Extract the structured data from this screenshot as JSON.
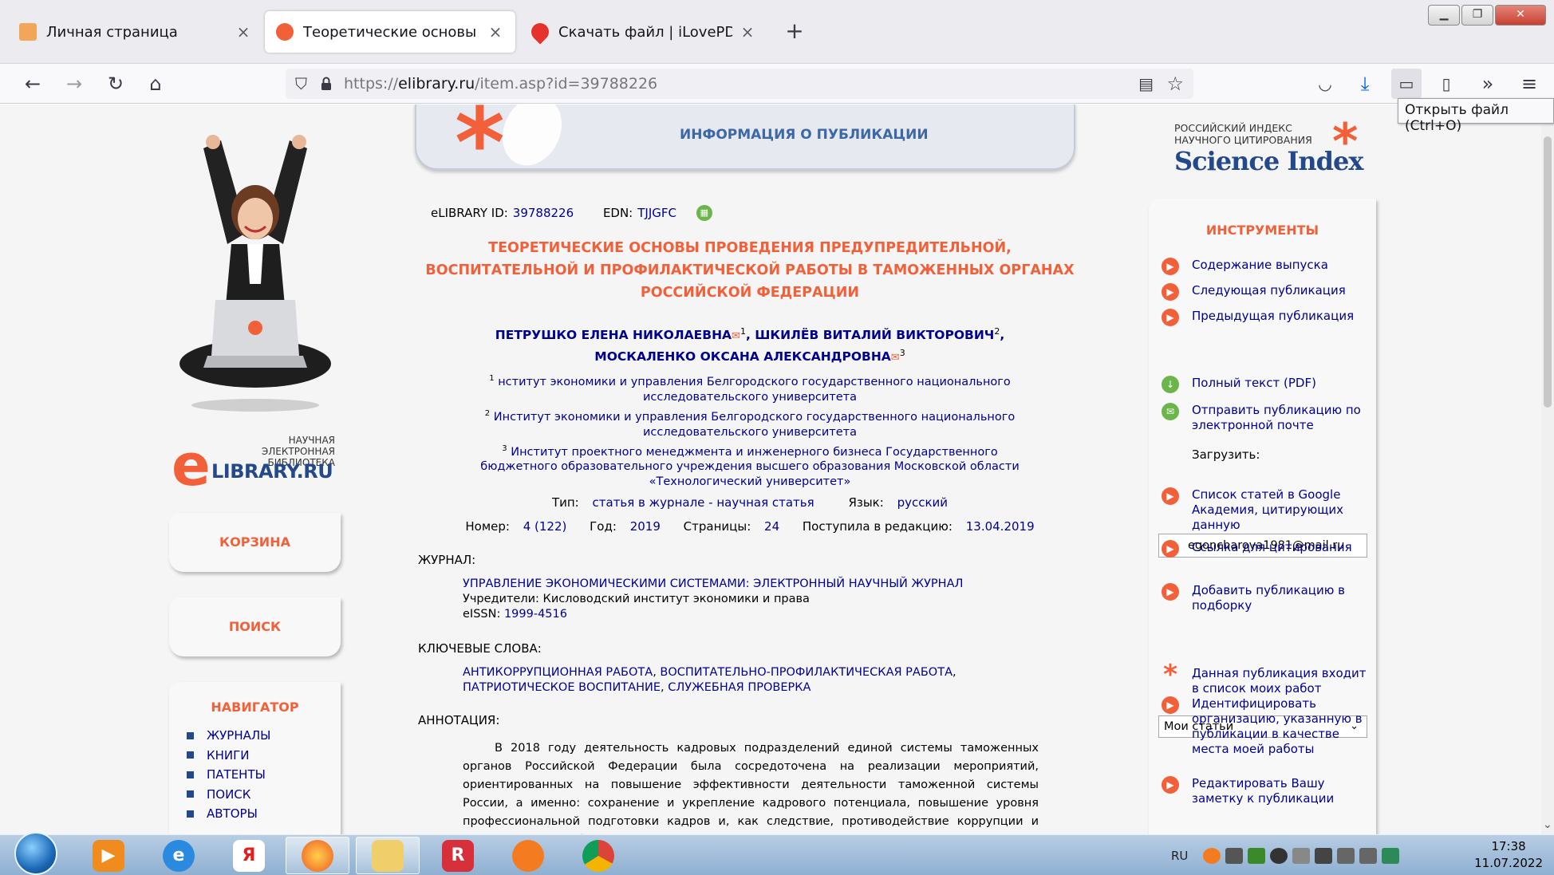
{
  "tabs": [
    {
      "label": "Личная страница",
      "close": "×"
    },
    {
      "label": "Теоретические основы прове…",
      "close": "×"
    },
    {
      "label": "Скачать файл | iLovePDF",
      "close": "×"
    }
  ],
  "new_tab": "+",
  "url": {
    "prefix": "https://",
    "domain": "elibrary.ru",
    "path": "/item.asp?id=39788226"
  },
  "tooltip": "Открыть файл (Ctrl+O)",
  "left": {
    "logo_small": "НАУЧНАЯ ЭЛЕКТРОННАЯ БИБЛИОТЕКА",
    "logo_big": "LIBRARY.RU",
    "logo_e": "e",
    "cart": "КОРЗИНА",
    "search": "ПОИСК",
    "nav_header": "НАВИГАТОР",
    "nav_items": [
      "ЖУРНАЛЫ",
      "КНИГИ",
      "ПАТЕНТЫ",
      "ПОИСК",
      "АВТОРЫ"
    ]
  },
  "header_title": "ИНФОРМАЦИЯ О ПУБЛИКАЦИИ",
  "ids": {
    "elibrary_label": "eLIBRARY ID:",
    "elibrary_id": "39788226",
    "edn_label": "EDN:",
    "edn": "TJJGFC"
  },
  "title_lines": [
    "ТЕОРЕТИЧЕСКИЕ ОСНОВЫ ПРОВЕДЕНИЯ ПРЕДУПРЕДИТЕЛЬНОЙ,",
    "ВОСПИТАТЕЛЬНОЙ И ПРОФИЛАКТИЧЕСКОЙ РАБОТЫ В ТАМОЖЕННЫХ ОРГАНАХ",
    "РОССИЙСКОЙ ФЕДЕРАЦИИ"
  ],
  "authors": [
    {
      "name": "ПЕТРУШКО ЕЛЕНА НИКОЛАЕВНА",
      "sup": "1",
      "sep": ", "
    },
    {
      "name": "ШКИЛЁВ ВИТАЛИЙ ВИКТОРОВИЧ",
      "sup": "2",
      "sep": ","
    },
    {
      "name": "МОСКАЛЕНКО ОКСАНА АЛЕКСАНДРОВНА",
      "sup": "3",
      "sep": ""
    }
  ],
  "affiliations": [
    {
      "sup": "1",
      "text": "нститут экономики и управления Белгородского государственного национального исследовательского университета"
    },
    {
      "sup": "2",
      "text": "Институт экономики и управления Белгородского государственного национального исследовательского университета"
    },
    {
      "sup": "3",
      "text": "Институт проектного менеджмента и инженерного бизнеса Государственного бюджетного образовательного учреждения высшего образования Московской области «Технологический университет»"
    }
  ],
  "meta": {
    "type_label": "Тип:",
    "type": "статья в журнале - научная статья",
    "lang_label": "Язык:",
    "lang": "русский",
    "number_label": "Номер:",
    "number": "4 (122)",
    "year_label": "Год:",
    "year": "2019",
    "pages_label": "Страницы:",
    "pages": "24",
    "received_label": "Поступила в редакцию:",
    "received": "13.04.2019"
  },
  "journal": {
    "label": "ЖУРНАЛ:",
    "name": "УПРАВЛЕНИЕ ЭКОНОМИЧЕСКИМИ СИСТЕМАМИ: ЭЛЕКТРОННЫЙ НАУЧНЫЙ ЖУРНАЛ",
    "founders": "Учредители: Кисловодский институт экономики и права",
    "eissn_label": "eISSN:",
    "eissn": "1999-4516"
  },
  "keywords": {
    "label": "КЛЮЧЕВЫЕ СЛОВА:",
    "items": [
      "АНТИКОРРУПЦИОННАЯ РАБОТА",
      "ВОСПИТАТЕЛЬНО-ПРОФИЛАКТИЧЕСКАЯ РАБОТА",
      "ПАТРИОТИЧЕСКОЕ ВОСПИТАНИЕ",
      "СЛУЖЕБНАЯ ПРОВЕРКА"
    ]
  },
  "abstract": {
    "label": "АННОТАЦИЯ:",
    "text": "В 2018 году деятельность кадровых подразделений единой системы таможенных органов Российской Федерации была сосредоточена на реализации мероприятий, ориентированных на повышение эффективности деятельности таможенной системы России, а именно: сохранение и укрепление кадрового потенциала, повышение уровня профессиональной подготовки кадров и, как следствие, противодействие коррупции и укрепление служебной дисциплины. Процедура"
  },
  "science_index": {
    "small1": "РОССИЙСКИЙ ИНДЕКС",
    "small2": "НАУЧНОГО ЦИТИРОВАНИЯ",
    "big": "Science Index"
  },
  "tools": {
    "header": "ИНСТРУМЕНТЫ",
    "items": [
      "Содержание выпуска",
      "Следующая публикация",
      "Предыдущая публикация",
      "Полный текст (PDF)",
      "Отправить публикацию по электронной почте",
      "Список статей в Google Академия, цитирующих данную",
      "Ссылка для цитирования",
      "Добавить публикацию в подборку",
      "Данная публикация входит в список моих работ",
      "Идентифицировать организацию, указанную в публикации в качестве места моей работы",
      "Редактировать Вашу заметку к публикации"
    ],
    "load_label": "Загрузить:",
    "email_value": "egoncharova1981@mail.ru",
    "select_value": "Мои статьи"
  },
  "taskbar": {
    "lang": "RU",
    "time": "17:38",
    "date": "11.07.2022"
  },
  "colors": {
    "accent_red": "#f2603a",
    "link_blue": "#00008f",
    "header_blue": "#3d68a7",
    "brand_navy": "#23488c",
    "green": "#6bb54a"
  }
}
